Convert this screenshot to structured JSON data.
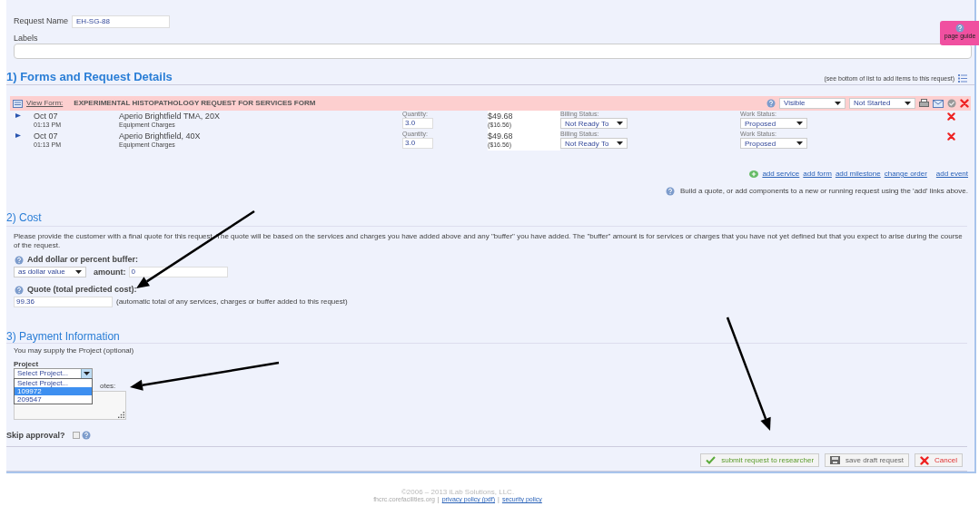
{
  "request_name": {
    "label": "Request Name",
    "value": "EH-SG-88"
  },
  "labels": {
    "label": "Labels"
  },
  "page_guide": {
    "label": "page guide"
  },
  "forms_section": {
    "title": "1) Forms and Request Details",
    "hint": "(see bottom of list to add items to this request)",
    "form": {
      "link": "View Form:",
      "name": "EXPERIMENTAL HISTOPATHOLOGY REQUEST FOR SERVICES FORM",
      "visibility": "Visible",
      "status": "Not Started"
    },
    "items": [
      {
        "date": "Oct 07",
        "time": "01:13 PM",
        "name": "Aperio Brightfield TMA, 20X",
        "category": "Equipment Charges",
        "quantity_label": "Quantity:",
        "quantity": "3.0",
        "price": "$49.68",
        "unit_price": "($16.56)",
        "billing_label": "Billing Status:",
        "billing": "Not Ready To",
        "work_label": "Work Status:",
        "work": "Proposed"
      },
      {
        "date": "Oct 07",
        "time": "01:13 PM",
        "name": "Aperio Brightfield, 40X",
        "category": "Equipment Charges",
        "quantity_label": "Quantity:",
        "quantity": "3.0",
        "price": "$49.68",
        "unit_price": "($16.56)",
        "billing_label": "Billing Status:",
        "billing": "Not Ready To",
        "work_label": "Work Status:",
        "work": "Proposed"
      }
    ],
    "add_links": [
      "add service",
      "add form",
      "add milestone",
      "change order",
      "add event"
    ],
    "info": "Build a quote, or add components to a new or running request using the 'add' links above."
  },
  "cost_section": {
    "title": "2) Cost",
    "description": "Please provide the customer with a final quote for this request. The quote will be based on the services and charges you have added above and any \"buffer\" you have added. The \"buffer\" amount is for services or charges that you have not yet defined but that you expect to arise during the course of the request.",
    "buffer_label": "Add dollar or percent buffer:",
    "buffer_type": "as dollar value",
    "amount_label": "amount:",
    "amount": "0",
    "quote_label": "Quote (total predicted cost):",
    "quote": "99.36",
    "quote_note": "(automatic total of any services, charges or buffer added to this request)"
  },
  "payment_section": {
    "title": "3) Payment Information",
    "intro": "You may supply the Project (optional)",
    "project_label": "Project",
    "project_select": "Select Project...",
    "project_options": [
      {
        "label": "Select Project...",
        "selected": false
      },
      {
        "label": "109972",
        "selected": true
      },
      {
        "label": "209547",
        "selected": false
      }
    ],
    "notes_label": "otes:",
    "skip_label": "Skip approval?",
    "skip_checked": false
  },
  "buttons": [
    {
      "kind": "submit",
      "label": "submit request to researcher"
    },
    {
      "kind": "save",
      "label": "save draft request"
    },
    {
      "kind": "cancel",
      "label": "Cancel"
    }
  ],
  "footer": {
    "copyright": "©2006 – 2013 iLab Solutions, LLC.",
    "site": "fhcrc.corefacilities.org",
    "separator": "|",
    "links": [
      "privacy policy (pdf)",
      "security policy"
    ]
  }
}
